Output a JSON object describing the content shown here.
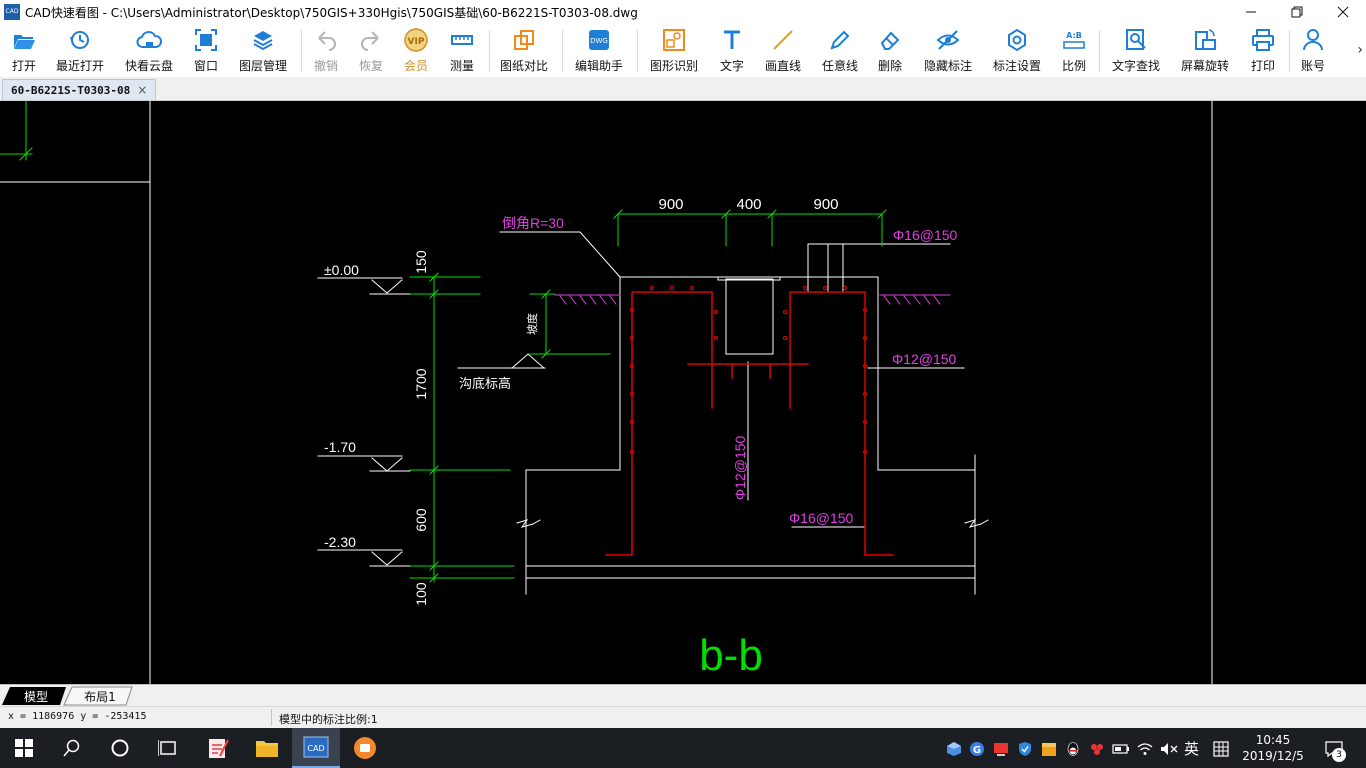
{
  "window": {
    "title": "CAD快速看图 - C:\\Users\\Administrator\\Desktop\\750GIS+330Hgis\\750GIS基础\\60-B6221S-T0303-08.dwg",
    "icon_label": "CAD",
    "minimize_icon": "minimize-icon",
    "maximize_icon": "restore-icon",
    "close_icon": "close-icon"
  },
  "toolbar": {
    "open": "打开",
    "recent": "最近打开",
    "cloud": "快看云盘",
    "window": "窗口",
    "layers": "图层管理",
    "undo": "撤销",
    "redo": "恢复",
    "vip": "会员",
    "measure": "测量",
    "compare": "图纸对比",
    "edit_helper": "编辑助手",
    "shape_recognize": "图形识别",
    "text": "文字",
    "draw_line": "画直线",
    "freehand_line": "任意线",
    "delete": "删除",
    "hide_annotation": "隐藏标注",
    "annotation_settings": "标注设置",
    "scale": "比例",
    "text_search": "文字查找",
    "screen_rotate": "屏幕旋转",
    "print": "打印",
    "account": "账号",
    "more_icon": "chevron-right-icon",
    "accent_color": "#1f7fd6"
  },
  "doc_tab": {
    "label": "60-B6221S-T0303-08",
    "close": "×"
  },
  "drawing": {
    "background": "#000000",
    "dim_top_left": "900",
    "dim_top_mid": "400",
    "dim_top_right": "900",
    "chamfer_label": "倒角R=30",
    "rebar_top_right": "Φ16@150",
    "rebar_right_mid": "Φ12@150",
    "rebar_center_vertical": "Φ12@150",
    "rebar_bottom": "Φ16@150",
    "elev_zero": "±0.00",
    "elev_minus_170": "-1.70",
    "elev_minus_230": "-2.30",
    "dim_vert_150": "150",
    "dim_vert_1700": "1700",
    "dim_vert_600": "600",
    "dim_vert_100": "100",
    "trench_bottom_label": "沟底标高",
    "slope_label": "坡度",
    "section_title": "b-b",
    "colors": {
      "dimension": "#00e000",
      "outline": "#ffffff",
      "rebar": "#e00000",
      "annotation": "#e040e0"
    }
  },
  "layout_tabs": [
    "模型",
    "布局1"
  ],
  "statusbar": {
    "coords": "x = 1186976  y = -253415",
    "scale_text": "模型中的标注比例:1"
  },
  "taskbar": {
    "start_icon": "windows-start-icon",
    "ime_label": "英",
    "time": "10:45",
    "date": "2019/12/5",
    "notifications": "3"
  }
}
